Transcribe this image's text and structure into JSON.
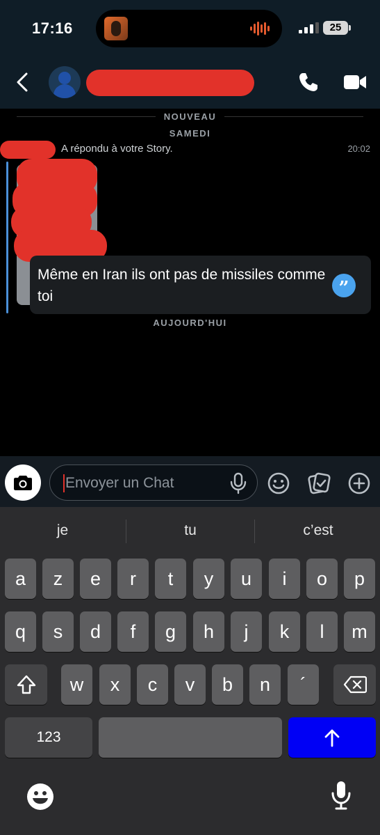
{
  "status_bar": {
    "time": "17:16",
    "battery": "25"
  },
  "header": {},
  "chat": {
    "new_label": "NOUVEAU",
    "day_saturday": "SAMEDI",
    "reply_notice": "A répondu à votre Story.",
    "message_time": "20:02",
    "message_text": "Même en Iran ils ont pas de missiles comme toi",
    "day_today": "AUJOURD'HUI"
  },
  "input": {
    "placeholder": "Envoyer un Chat"
  },
  "keyboard": {
    "suggestions": [
      "je",
      "tu",
      "c’est"
    ],
    "row1": [
      "a",
      "z",
      "e",
      "r",
      "t",
      "y",
      "u",
      "i",
      "o",
      "p"
    ],
    "row2": [
      "q",
      "s",
      "d",
      "f",
      "g",
      "h",
      "j",
      "k",
      "l",
      "m"
    ],
    "row3": [
      "w",
      "x",
      "c",
      "v",
      "b",
      "n",
      "´"
    ],
    "numbers_key": "123"
  },
  "colors": {
    "accent_blue": "#4aa3ee",
    "return_key": "#0000f5",
    "redaction": "#e2322a",
    "header_bg": "#0f1d27"
  },
  "icons": [
    "back-icon",
    "call-icon",
    "video-icon",
    "quote-icon",
    "camera-icon",
    "mic-icon",
    "emoji-icon",
    "sticker-icon",
    "plus-icon",
    "shift-icon",
    "delete-icon",
    "return-arrow-icon"
  ]
}
